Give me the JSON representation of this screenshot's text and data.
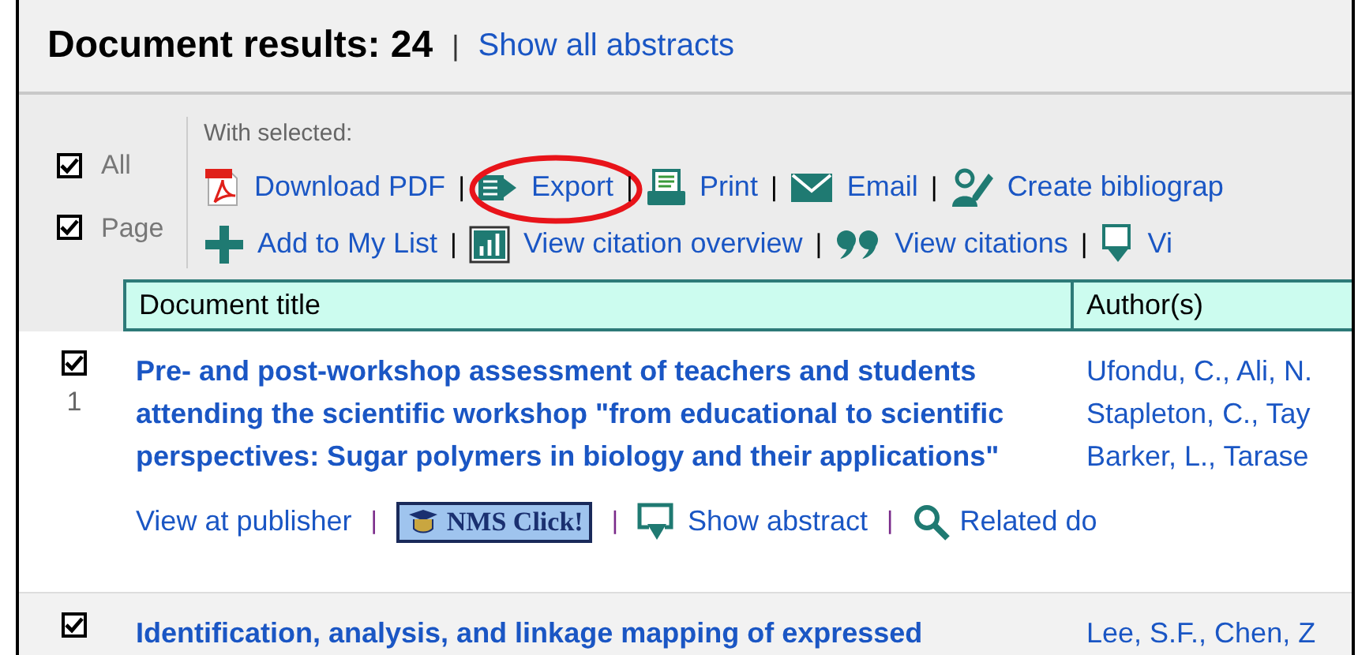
{
  "header": {
    "title": "Document results: 24",
    "separator": "|",
    "link": "Show all abstracts"
  },
  "select": [
    {
      "label": "All",
      "checked": true
    },
    {
      "label": "Page",
      "checked": true
    }
  ],
  "toolbar": {
    "caption": "With selected:",
    "separator": "|",
    "lines": [
      {
        "items": [
          {
            "kind": "pdf",
            "label": "Download PDF",
            "highlighted": false
          },
          {
            "kind": "export",
            "label": "Export",
            "highlighted": true
          },
          {
            "kind": "print",
            "label": "Print",
            "highlighted": false
          },
          {
            "kind": "email",
            "label": "Email",
            "highlighted": false
          },
          {
            "kind": "bibliography",
            "label": "Create bibliograp",
            "highlighted": false
          }
        ]
      },
      {
        "items": [
          {
            "kind": "plus",
            "label": "Add to My List",
            "highlighted": false
          },
          {
            "kind": "chart",
            "label": "View citation overview",
            "highlighted": false
          },
          {
            "kind": "quote",
            "label": "View citations",
            "highlighted": false
          },
          {
            "kind": "download",
            "label": "Vi",
            "highlighted": false
          }
        ]
      }
    ]
  },
  "table": {
    "columns": [
      "Document title",
      "Author(s)"
    ],
    "rows": [
      {
        "checked": true,
        "number": "1",
        "title": "Pre- and post-workshop assessment of teachers and students attending the scientific workshop \"from educational to scientific perspectives: Sugar polymers in biology and their applications\"",
        "authors": [
          "Ufondu, C., Ali, N.",
          "Stapleton, C., Tay",
          "Barker, L., Tarase"
        ],
        "actions": [
          {
            "kind": "link",
            "label": "View at publisher"
          },
          {
            "kind": "banner",
            "label": "NMS Click!"
          },
          {
            "kind": "abstract",
            "label": "Show abstract"
          },
          {
            "kind": "search",
            "label": "Related do"
          }
        ]
      },
      {
        "checked": true,
        "title": "Identification, analysis, and linkage mapping of expressed",
        "authors": [
          "Lee, S.F., Chen, Z"
        ]
      }
    ]
  }
}
